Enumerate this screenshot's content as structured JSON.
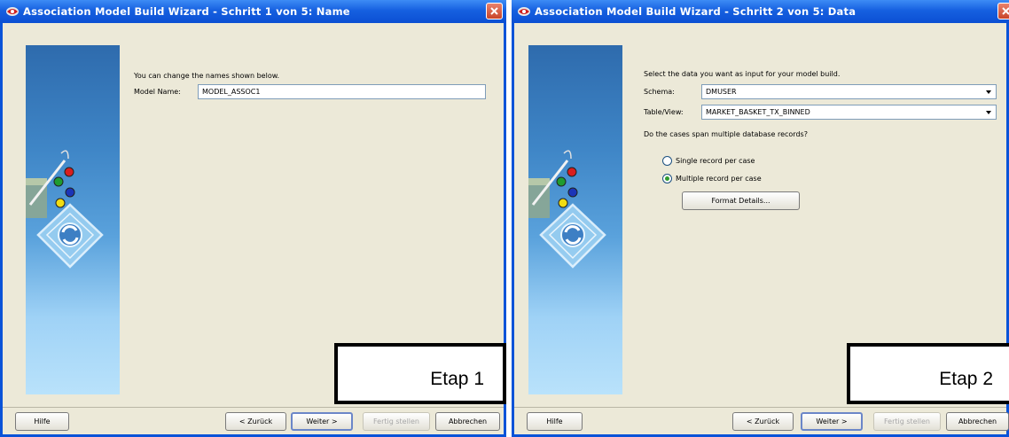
{
  "colors": {
    "titlebar": "#0b4fd3",
    "dialog_bg": "#ece9d8",
    "close_red": "#c8452a"
  },
  "window1": {
    "title": "Association Model Build Wizard - Schritt 1 von 5: Name",
    "intro": "You can change the names shown below.",
    "model_name_label": "Model Name:",
    "model_name_value": "MODEL_ASSOC1",
    "buttons": {
      "help": "Hilfe",
      "back": "< Zurück",
      "next": "Weiter >",
      "finish": "Fertig stellen",
      "cancel": "Abbrechen"
    },
    "etap_label": "Etap 1"
  },
  "window2": {
    "title": "Association Model Build Wizard - Schritt 2 von 5: Data",
    "intro": "Select the data you want as input for your model build.",
    "schema_label": "Schema:",
    "schema_value": "DMUSER",
    "table_label": "Table/View:",
    "table_value": "MARKET_BASKET_TX_BINNED",
    "question": "Do the cases span multiple database records?",
    "radio_single": "Single record per case",
    "radio_multiple": "Multiple record per case",
    "selected_option": "Multiple record per case",
    "format_details_button": "Format Details...",
    "buttons": {
      "help": "Hilfe",
      "back": "< Zurück",
      "next": "Weiter >",
      "finish": "Fertig stellen",
      "cancel": "Abbrechen"
    },
    "etap_label": "Etap 2"
  }
}
